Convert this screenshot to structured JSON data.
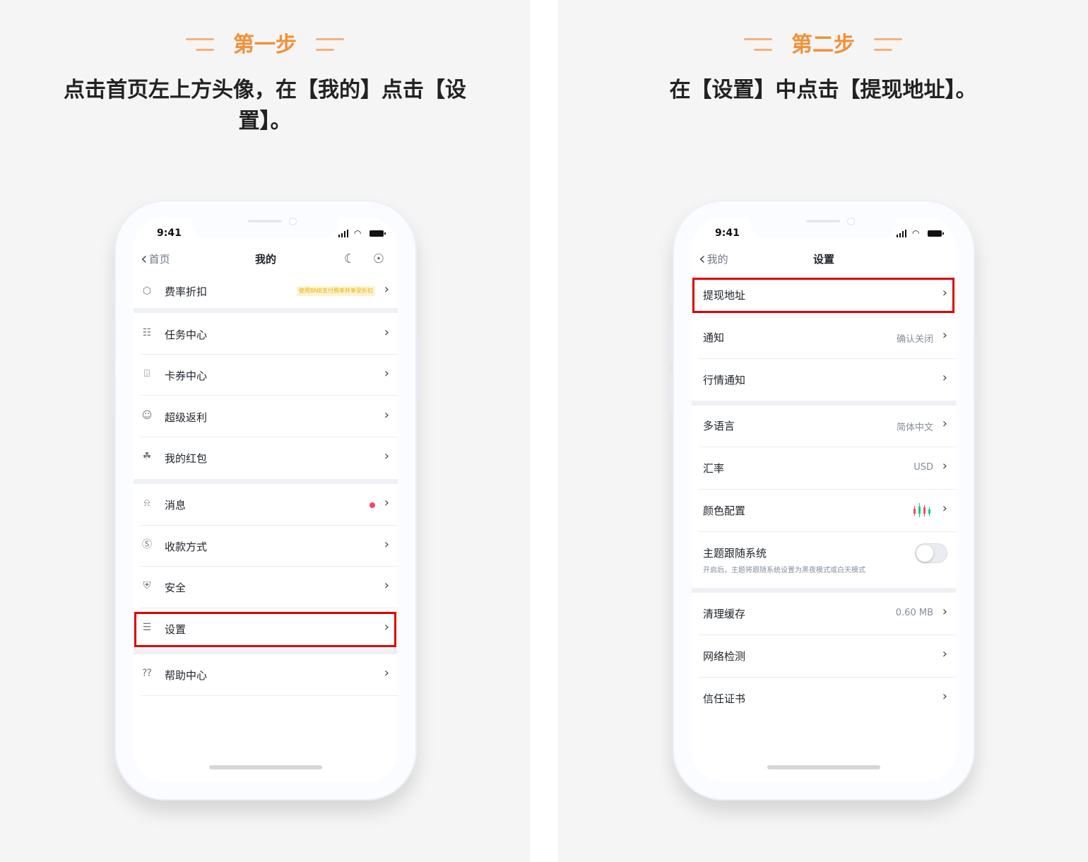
{
  "colors": {
    "accent_orange": "#f0913a",
    "highlight_red": "#e00000",
    "promo_yellow": "#e8b400",
    "notify_red": "#f6465d"
  },
  "step1": {
    "title": "第一步",
    "instruction": "点击首页左上方头像，在【我的】点击【设置】。",
    "phone": {
      "time": "9:41",
      "back_label": "首页",
      "page_title": "我的",
      "icons": [
        "moon-icon",
        "headset-icon"
      ],
      "promo": {
        "label": "费率折扣",
        "badge": "使用BNB支付费率并享受折扣",
        "icon": "discount-icon"
      },
      "group1": [
        {
          "label": "任务中心",
          "icon": "clipboard-icon"
        },
        {
          "label": "卡券中心",
          "icon": "ticket-icon"
        },
        {
          "label": "超级返利",
          "icon": "user-plus-icon"
        },
        {
          "label": "我的红包",
          "icon": "gift-icon"
        }
      ],
      "group2": [
        {
          "label": "消息",
          "icon": "bell-icon"
        },
        {
          "label": "收款方式",
          "icon": "dollar-icon"
        },
        {
          "label": "安全",
          "icon": "shield-icon"
        },
        {
          "label": "设置",
          "icon": "sliders-icon"
        }
      ],
      "group3": [
        {
          "label": "帮助中心",
          "icon": "help-icon"
        }
      ]
    }
  },
  "step2": {
    "title": "第二步",
    "instruction": "在【设置】中点击【提现地址】。",
    "phone": {
      "time": "9:41",
      "back_label": "我的",
      "page_title": "设置",
      "group1": [
        {
          "label": "提现地址",
          "value": ""
        },
        {
          "label": "通知",
          "value": "确认关闭"
        },
        {
          "label": "行情通知",
          "value": ""
        }
      ],
      "group2": [
        {
          "label": "多语言",
          "value": "简体中文"
        },
        {
          "label": "汇率",
          "value": "USD"
        },
        {
          "label": "颜色配置",
          "value": ""
        },
        {
          "label": "主题跟随系统",
          "note": "开启后，主题将跟随系统设置为黑夜模式或白天模式"
        }
      ],
      "group3": [
        {
          "label": "清理缓存",
          "value": "0.60 MB"
        },
        {
          "label": "网络检测",
          "value": ""
        },
        {
          "label": "信任证书",
          "value": ""
        }
      ]
    }
  }
}
